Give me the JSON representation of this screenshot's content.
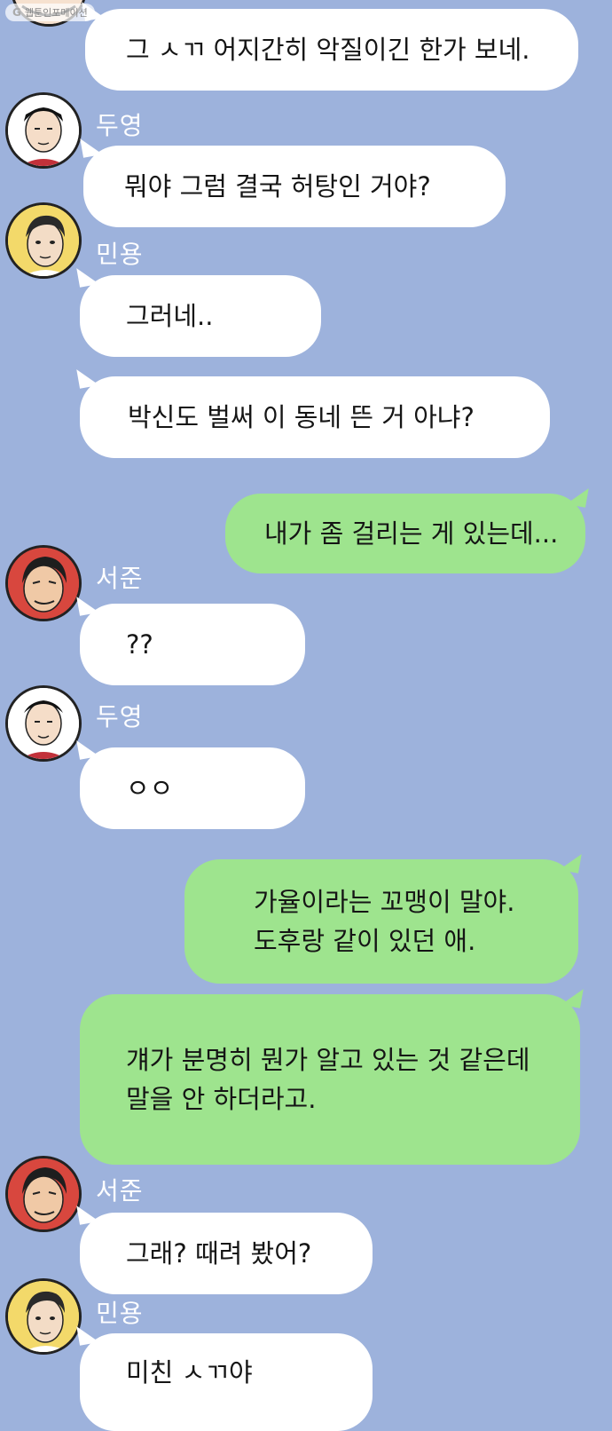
{
  "watermark": {
    "logo": "G",
    "text": "웹툰인포메이션"
  },
  "colors": {
    "background": "#9db2dc",
    "bubble_other": "#ffffff",
    "bubble_me": "#9ee48e"
  },
  "messages": [
    {
      "text": "그 ㅅㄲ 어지간히 악질이긴 한가 보네."
    },
    {
      "sender": "두영",
      "text": "뭐야 그럼 결국 허탕인 거야?"
    },
    {
      "sender": "민용",
      "text": "그러네.."
    },
    {
      "text": "박신도 벌써 이 동네 뜬 거 아냐?"
    },
    {
      "text": "내가 좀 걸리는 게 있는데..."
    },
    {
      "sender": "서준",
      "text": "??"
    },
    {
      "sender": "두영",
      "text": "ㅇㅇ"
    },
    {
      "text": "가율이라는 꼬맹이 말야.\n도후랑 같이 있던 애."
    },
    {
      "text": "걔가 분명히 뭔가 알고 있는 것 같은데\n말을 안 하더라고."
    },
    {
      "sender": "서준",
      "text": "그래? 때려 봤어?"
    },
    {
      "sender": "민용",
      "text": "미친 ㅅㄲ야"
    }
  ]
}
